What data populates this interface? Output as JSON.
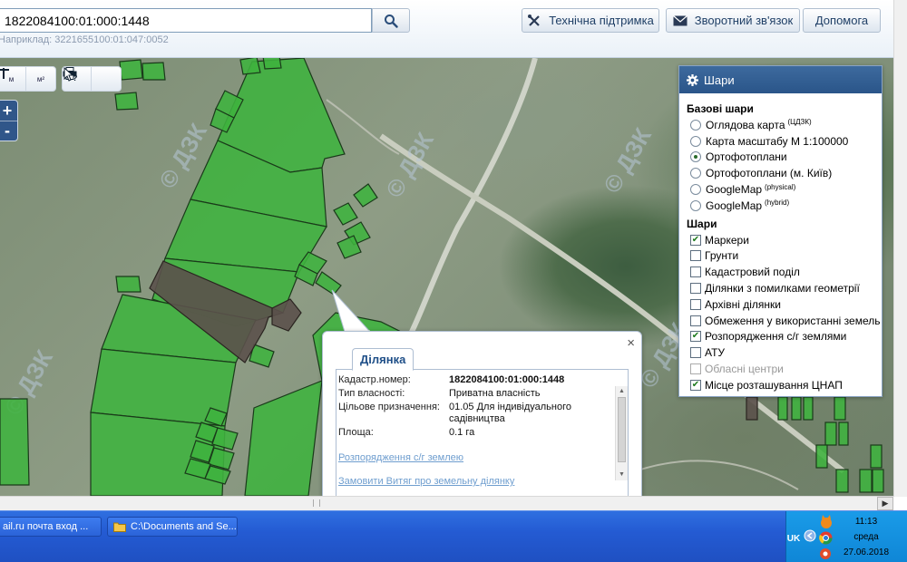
{
  "search": {
    "value": "1822084100:01:000:1448",
    "example": "Наприклад: 3221655100:01:047:0052"
  },
  "header_buttons": {
    "support": "Технічна підтримка",
    "feedback": "Зворотний зв'язок",
    "help": "Допомога"
  },
  "map_tools": {
    "measure_length_label": "м",
    "measure_area_label": "м²",
    "zoom_in": "+",
    "zoom_out": "-"
  },
  "layers_panel": {
    "title": "Шари",
    "base_title": "Базові шари",
    "base_layers": [
      {
        "label": "Оглядова карта",
        "sup": "(ЦДЗК)",
        "selected": false
      },
      {
        "label": "Карта масштабу М 1:100000",
        "sup": "",
        "selected": false
      },
      {
        "label": "Ортофотоплани",
        "sup": "",
        "selected": true
      },
      {
        "label": "Ортофотоплани (м. Київ)",
        "sup": "",
        "selected": false
      },
      {
        "label": "GoogleMap",
        "sup": "(physical)",
        "selected": false
      },
      {
        "label": "GoogleMap",
        "sup": "(hybrid)",
        "selected": false
      }
    ],
    "overlay_title": "Шари",
    "overlays": [
      {
        "label": "Маркери",
        "checked": true,
        "disabled": false
      },
      {
        "label": "Грунти",
        "checked": false,
        "disabled": false
      },
      {
        "label": "Кадастровий поділ",
        "checked": false,
        "disabled": false
      },
      {
        "label": "Ділянки з помилками геометрії",
        "checked": false,
        "disabled": false
      },
      {
        "label": "Архівні ділянки",
        "checked": false,
        "disabled": false
      },
      {
        "label": "Обмеження у використанні земель",
        "checked": false,
        "disabled": false
      },
      {
        "label": "Розпорядження с/г землями",
        "checked": true,
        "disabled": false
      },
      {
        "label": "АТУ",
        "checked": false,
        "disabled": false
      },
      {
        "label": "Обласні центри",
        "checked": false,
        "disabled": true
      },
      {
        "label": "Місце розташування ЦНАП",
        "checked": true,
        "disabled": false
      }
    ]
  },
  "parcel_popup": {
    "tab": "Ділянка",
    "fields": [
      {
        "label": "Кадастр.номер:",
        "value": "1822084100:01:000:1448",
        "bold": true
      },
      {
        "label": "Тип власності:",
        "value": "Приватна власність",
        "bold": false
      },
      {
        "label": "Цільове призначення:",
        "value": "01.05 Для індивідуального садівництва",
        "bold": false
      },
      {
        "label": "Площа:",
        "value": "0.1 га",
        "bold": false
      }
    ],
    "links": [
      "Розпорядження с/г землею",
      "Замовити Витяг про земельну ділянку"
    ],
    "close": "×"
  },
  "watermark": "© ДЗК",
  "taskbar": {
    "tasks": [
      "ail.ru почта вход ...",
      "C:\\Documents and Se..."
    ],
    "lang": "UK",
    "time": "11:13",
    "day": "среда",
    "date": "27.06.2018"
  },
  "colors": {
    "parcel_green": "#3fb33f",
    "parcel_dark": "#5b514b",
    "header_blue": "#2a5589",
    "link_blue": "#6f9ecf"
  }
}
